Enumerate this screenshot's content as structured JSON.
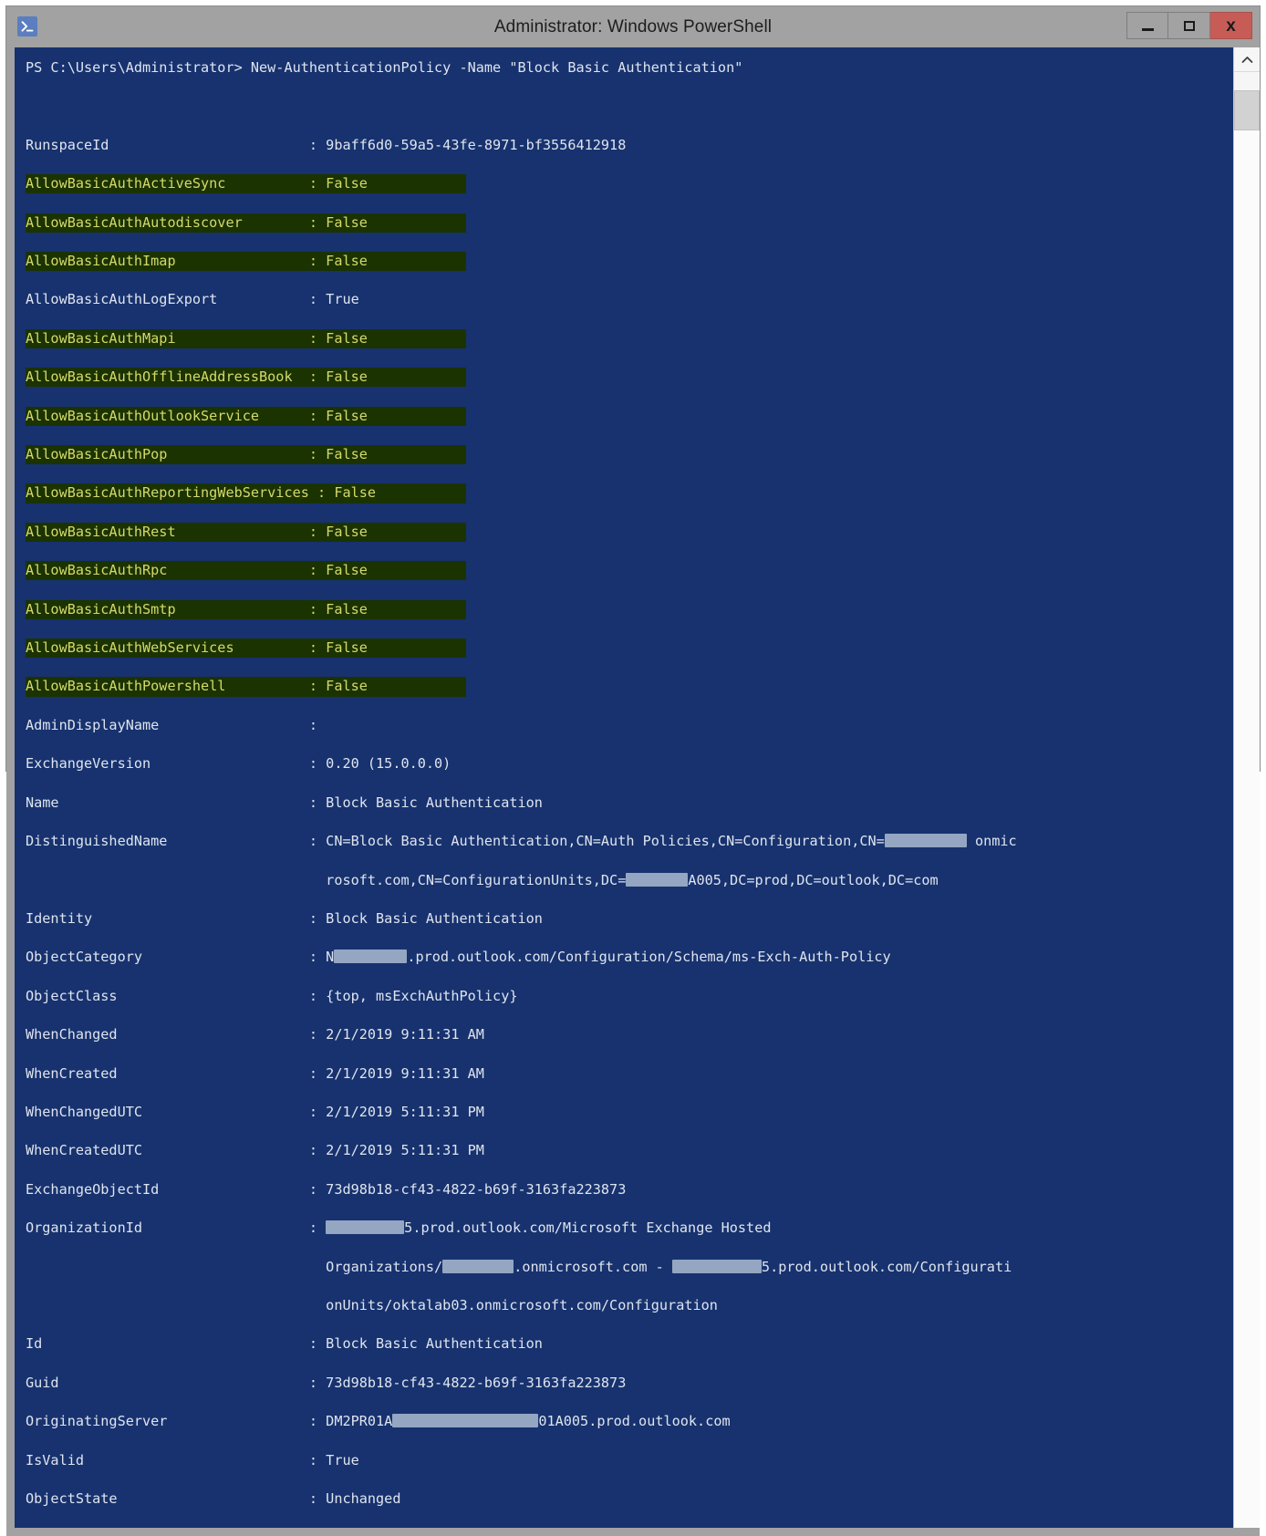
{
  "window": {
    "title": "Administrator: Windows PowerShell",
    "app_icon": "powershell-icon",
    "controls": {
      "minimize_label": "Minimize",
      "maximize_label": "Maximize",
      "close_label": "x"
    }
  },
  "scrollbar": {
    "up_arrow": "chevron-up-icon",
    "position": "top"
  },
  "colors": {
    "console_bg": "#17326e",
    "console_fg": "#dfe4ef",
    "highlight_bg": "#1b3300",
    "highlight_fg": "#d5d96a",
    "titlebar_bg": "#a2a2a2",
    "close_btn_bg": "#c75c57",
    "redaction": "#9fb0c9"
  },
  "console": {
    "prompt_line": "PS C:\\Users\\Administrator> New-AuthenticationPolicy -Name \"Block Basic Authentication\"",
    "properties": [
      {
        "name": "RunspaceId",
        "value": "9baff6d0-59a5-43fe-8971-bf3556412918",
        "highlight": false
      },
      {
        "name": "AllowBasicAuthActiveSync",
        "value": "False",
        "highlight": true
      },
      {
        "name": "AllowBasicAuthAutodiscover",
        "value": "False",
        "highlight": true
      },
      {
        "name": "AllowBasicAuthImap",
        "value": "False",
        "highlight": true
      },
      {
        "name": "AllowBasicAuthLogExport",
        "value": "True",
        "highlight": false
      },
      {
        "name": "AllowBasicAuthMapi",
        "value": "False",
        "highlight": true
      },
      {
        "name": "AllowBasicAuthOfflineAddressBook",
        "value": "False",
        "highlight": true
      },
      {
        "name": "AllowBasicAuthOutlookService",
        "value": "False",
        "highlight": true
      },
      {
        "name": "AllowBasicAuthPop",
        "value": "False",
        "highlight": true
      },
      {
        "name": "AllowBasicAuthReportingWebServices",
        "value": "False",
        "highlight": true
      },
      {
        "name": "AllowBasicAuthRest",
        "value": "False",
        "highlight": true
      },
      {
        "name": "AllowBasicAuthRpc",
        "value": "False",
        "highlight": true
      },
      {
        "name": "AllowBasicAuthSmtp",
        "value": "False",
        "highlight": true
      },
      {
        "name": "AllowBasicAuthWebServices",
        "value": "False",
        "highlight": true
      },
      {
        "name": "AllowBasicAuthPowershell",
        "value": "False",
        "highlight": true
      },
      {
        "name": "AdminDisplayName",
        "value": "",
        "highlight": false
      },
      {
        "name": "ExchangeVersion",
        "value": "0.20 (15.0.0.0)",
        "highlight": false
      },
      {
        "name": "Name",
        "value": "Block Basic Authentication",
        "highlight": false
      },
      {
        "name": "DistinguishedName",
        "value": "CN=Block Basic Authentication,CN=Auth Policies,CN=Configuration,CN=[redacted] onmicrosoft.com,CN=ConfigurationUnits,DC=[redacted]A005,DC=prod,DC=outlook,DC=com",
        "highlight": false
      },
      {
        "name": "Identity",
        "value": "Block Basic Authentication",
        "highlight": false
      },
      {
        "name": "ObjectCategory",
        "value": "N[redacted].prod.outlook.com/Configuration/Schema/ms-Exch-Auth-Policy",
        "highlight": false
      },
      {
        "name": "ObjectClass",
        "value": "{top, msExchAuthPolicy}",
        "highlight": false
      },
      {
        "name": "WhenChanged",
        "value": "2/1/2019 9:11:31 AM",
        "highlight": false
      },
      {
        "name": "WhenCreated",
        "value": "2/1/2019 9:11:31 AM",
        "highlight": false
      },
      {
        "name": "WhenChangedUTC",
        "value": "2/1/2019 5:11:31 PM",
        "highlight": false
      },
      {
        "name": "WhenCreatedUTC",
        "value": "2/1/2019 5:11:31 PM",
        "highlight": false
      },
      {
        "name": "ExchangeObjectId",
        "value": "73d98b18-cf43-4822-b69f-3163fa223873",
        "highlight": false
      },
      {
        "name": "OrganizationId",
        "value": "[redacted]5.prod.outlook.com/Microsoft Exchange Hosted Organizations/[redacted].onmicrosoft.com - [redacted]5.prod.outlook.com/ConfigurationUnits/oktalab03.onmicrosoft.com/Configuration",
        "highlight": false
      },
      {
        "name": "Id",
        "value": "Block Basic Authentication",
        "highlight": false
      },
      {
        "name": "Guid",
        "value": "73d98b18-cf43-4822-b69f-3163fa223873",
        "highlight": false
      },
      {
        "name": "OriginatingServer",
        "value": "DM2PR01A[redacted]01A005.prod.outlook.com",
        "highlight": false
      },
      {
        "name": "IsValid",
        "value": "True",
        "highlight": false
      },
      {
        "name": "ObjectState",
        "value": "Unchanged",
        "highlight": false
      }
    ],
    "text_lines": [
      {
        "t": "prompt",
        "s": "PS C:\\Users\\Administrator> New-AuthenticationPolicy -Name \"Block Basic Authentication\""
      },
      {
        "t": "blank",
        "s": ""
      },
      {
        "t": "blank",
        "s": ""
      },
      {
        "t": "plain",
        "s": "RunspaceId                        : 9baff6d0-59a5-43fe-8971-bf3556412918"
      },
      {
        "t": "hl",
        "s": "AllowBasicAuthActiveSync          : False"
      },
      {
        "t": "hl",
        "s": "AllowBasicAuthAutodiscover        : False"
      },
      {
        "t": "hl",
        "s": "AllowBasicAuthImap                : False"
      },
      {
        "t": "plain",
        "s": "AllowBasicAuthLogExport           : True"
      },
      {
        "t": "hl",
        "s": "AllowBasicAuthMapi                : False"
      },
      {
        "t": "hl",
        "s": "AllowBasicAuthOfflineAddressBook  : False"
      },
      {
        "t": "hl",
        "s": "AllowBasicAuthOutlookService      : False"
      },
      {
        "t": "hl",
        "s": "AllowBasicAuthPop                 : False"
      },
      {
        "t": "hl",
        "s": "AllowBasicAuthReportingWebServices : False"
      },
      {
        "t": "hl",
        "s": "AllowBasicAuthRest                : False"
      },
      {
        "t": "hl",
        "s": "AllowBasicAuthRpc                 : False"
      },
      {
        "t": "hl",
        "s": "AllowBasicAuthSmtp                : False"
      },
      {
        "t": "hl",
        "s": "AllowBasicAuthWebServices         : False"
      },
      {
        "t": "hl",
        "s": "AllowBasicAuthPowershell          : False"
      },
      {
        "t": "plain",
        "s": "AdminDisplayName                  :"
      },
      {
        "t": "plain",
        "s": "ExchangeVersion                   : 0.20 (15.0.0.0)"
      },
      {
        "t": "plain",
        "s": "Name                              : Block Basic Authentication"
      },
      {
        "t": "redact",
        "s": "DistinguishedName                 : CN=Block Basic Authentication,CN=Auth Policies,CN=Configuration,CN=",
        "after": " onmic",
        "rw": 90
      },
      {
        "t": "redact2",
        "s": "                                    rosoft.com,CN=ConfigurationUnits,DC=",
        "after": "A005,DC=prod,DC=outlook,DC=com",
        "rw": 68
      },
      {
        "t": "plain",
        "s": "Identity                          : Block Basic Authentication"
      },
      {
        "t": "redact",
        "s": "ObjectCategory                    : N",
        "after": ".prod.outlook.com/Configuration/Schema/ms-Exch-Auth-Policy",
        "rw": 80
      },
      {
        "t": "plain",
        "s": "ObjectClass                       : {top, msExchAuthPolicy}"
      },
      {
        "t": "plain",
        "s": "WhenChanged                       : 2/1/2019 9:11:31 AM"
      },
      {
        "t": "plain",
        "s": "WhenCreated                       : 2/1/2019 9:11:31 AM"
      },
      {
        "t": "plain",
        "s": "WhenChangedUTC                    : 2/1/2019 5:11:31 PM"
      },
      {
        "t": "plain",
        "s": "WhenCreatedUTC                    : 2/1/2019 5:11:31 PM"
      },
      {
        "t": "plain",
        "s": "ExchangeObjectId                  : 73d98b18-cf43-4822-b69f-3163fa223873"
      },
      {
        "t": "redact",
        "s": "OrganizationId                    : ",
        "after": "5.prod.outlook.com/Microsoft Exchange Hosted",
        "rw": 86
      },
      {
        "t": "redact3",
        "s": "                                    Organizations/",
        "mid": ".onmicrosoft.com - ",
        "after": "5.prod.outlook.com/Configurati",
        "rw": 78,
        "rw2": 98
      },
      {
        "t": "plain",
        "s": "                                    onUnits/oktalab03.onmicrosoft.com/Configuration"
      },
      {
        "t": "plain",
        "s": "Id                                : Block Basic Authentication"
      },
      {
        "t": "plain",
        "s": "Guid                              : 73d98b18-cf43-4822-b69f-3163fa223873"
      },
      {
        "t": "redact",
        "s": "OriginatingServer                 : DM2PR01A",
        "after": "01A005.prod.outlook.com",
        "rw": 160
      },
      {
        "t": "plain",
        "s": "IsValid                           : True"
      },
      {
        "t": "plain",
        "s": "ObjectState                       : Unchanged"
      }
    ]
  }
}
